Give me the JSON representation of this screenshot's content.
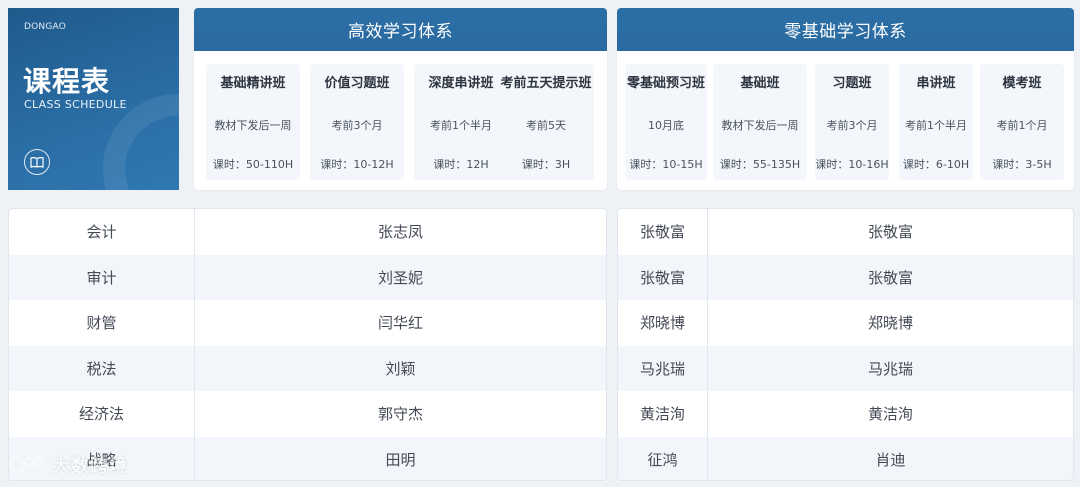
{
  "brand": {
    "small": "DONGAO",
    "title": "课程表",
    "subtitle": "CLASS SCHEDULE"
  },
  "systemA": {
    "title": "高效学习体系",
    "courses": [
      {
        "name": "基础精讲班",
        "time": "教材下发后一周",
        "hours": "课时：50-110H"
      },
      {
        "name": "价值习题班",
        "time": "考前3个月",
        "hours": "课时：10-12H"
      },
      {
        "name": "深度串讲班",
        "time": "考前1个半月",
        "hours": "课时：12H"
      },
      {
        "name": "考前五天提示班",
        "time": "考前5天",
        "hours": "课时：3H"
      }
    ]
  },
  "systemB": {
    "title": "零基础学习体系",
    "courses": [
      {
        "name": "零基础预习班",
        "time": "10月底",
        "hours": "课时：10-15H"
      },
      {
        "name": "基础班",
        "time": "教材下发后一周",
        "hours": "课时：55-135H"
      },
      {
        "name": "习题班",
        "time": "考前3个月",
        "hours": "课时：10-16H"
      },
      {
        "name": "串讲班",
        "time": "考前1个半月",
        "hours": "课时：6-10H"
      },
      {
        "name": "模考班",
        "time": "考前1个月",
        "hours": "课时：3-5H"
      }
    ]
  },
  "tableA": {
    "rows": [
      {
        "subject": "会计",
        "teacher": "张志凤"
      },
      {
        "subject": "审计",
        "teacher": "刘圣妮"
      },
      {
        "subject": "财管",
        "teacher": "闫华红"
      },
      {
        "subject": "税法",
        "teacher": "刘颖"
      },
      {
        "subject": "经济法",
        "teacher": "郭守杰"
      },
      {
        "subject": "战略",
        "teacher": "田明"
      }
    ]
  },
  "tableB": {
    "rows": [
      {
        "t1": "张敬富",
        "t2": "张敬富"
      },
      {
        "t1": "张敬富",
        "t2": "张敬富"
      },
      {
        "t1": "郑晓博",
        "t2": "郑晓博"
      },
      {
        "t1": "马兆瑞",
        "t2": "马兆瑞"
      },
      {
        "t1": "黄洁洵",
        "t2": "黄洁洵"
      },
      {
        "t1": "征鸿",
        "t2": "肖迪"
      }
    ]
  },
  "watermark": {
    "text": "大数跨境"
  },
  "colors": {
    "header": "#2b6fa6",
    "brand": "#1f5a8c",
    "cardBg": "#f3f7fb",
    "rowAlt": "#f2f6fa"
  }
}
